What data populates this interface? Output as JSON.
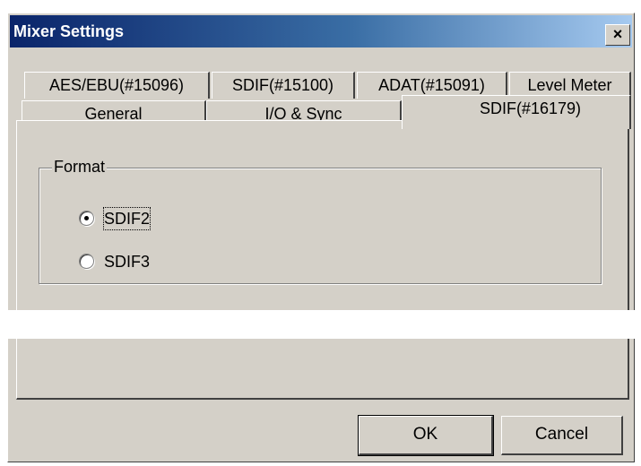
{
  "window": {
    "title": "Mixer Settings",
    "close_label": "×"
  },
  "tabs": {
    "row1": [
      "AES/EBU(#15096)",
      "SDIF(#15100)",
      "ADAT(#15091)",
      "Level Meter"
    ],
    "row2": [
      "General",
      "I/O & Sync",
      "SDIF(#16179)"
    ],
    "active": "SDIF(#16179)"
  },
  "format_group": {
    "label": "Format",
    "options": [
      {
        "label": "SDIF2",
        "checked": true
      },
      {
        "label": "SDIF3",
        "checked": false
      }
    ]
  },
  "buttons": {
    "ok_label": "OK",
    "cancel_label": "Cancel"
  }
}
